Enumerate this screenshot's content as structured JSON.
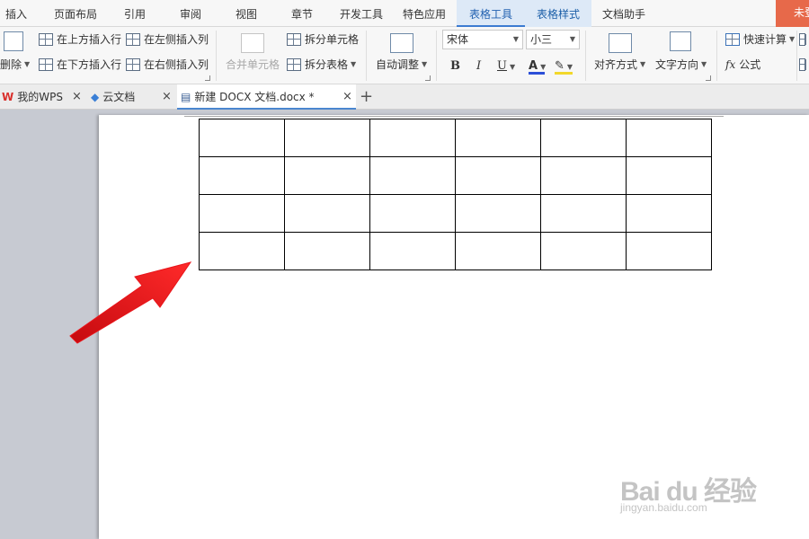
{
  "menu": {
    "tabs": [
      "插入",
      "页面布局",
      "引用",
      "审阅",
      "视图",
      "章节",
      "开发工具",
      "特色应用",
      "表格工具",
      "表格样式",
      "文档助手"
    ],
    "corner_label": "未登录"
  },
  "ribbon": {
    "delete_label": "删除",
    "insert_above": "在上方插入行",
    "insert_below": "在下方插入行",
    "insert_left": "在左侧插入列",
    "insert_right": "在右侧插入列",
    "merge_cells": "合并单元格",
    "split_cells": "拆分单元格",
    "split_table": "拆分表格",
    "auto_adjust": "自动调整",
    "font_name": "宋体",
    "font_size": "小三",
    "bold": "B",
    "italic": "I",
    "underline": "U",
    "font_color_glyph": "A",
    "font_color": "#2c4fd8",
    "highlight_color": "#f2d82b",
    "align": "对齐方式",
    "text_direction": "文字方向",
    "quick_calc": "快速计算",
    "formula": "公式",
    "fx": "fx"
  },
  "doc_tabs": {
    "tabs": [
      {
        "label": "我的WPS"
      },
      {
        "label": "云文档"
      },
      {
        "label": "新建 DOCX 文档.docx *"
      }
    ],
    "add_label": "+"
  },
  "table": {
    "rows": 4,
    "cols": 6
  },
  "annotation": {
    "arrow_color": "#e8141a"
  },
  "watermark": {
    "logo_text": "Bai du 经验",
    "url": "jingyan.baidu.com"
  }
}
